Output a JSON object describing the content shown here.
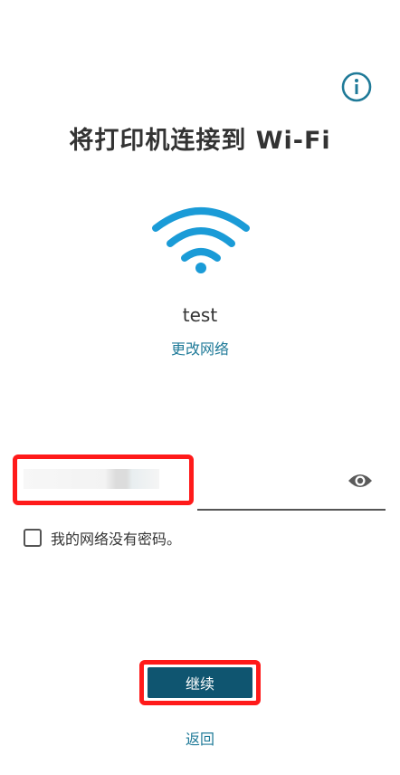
{
  "header": {
    "title": "将打印机连接到 Wi-Fi",
    "info_icon": "info-icon"
  },
  "network": {
    "icon": "wifi-icon",
    "name": "test",
    "change_label": "更改网络"
  },
  "password": {
    "value": "",
    "placeholder": "",
    "visibility_icon": "eye-icon"
  },
  "no_password": {
    "label": "我的网络没有密码。",
    "checked": false
  },
  "actions": {
    "continue_label": "继续",
    "back_label": "返回"
  },
  "colors": {
    "accent": "#1f7a98",
    "primary_button": "#0f5570",
    "highlight": "#ff1a1a",
    "text": "#333333"
  }
}
